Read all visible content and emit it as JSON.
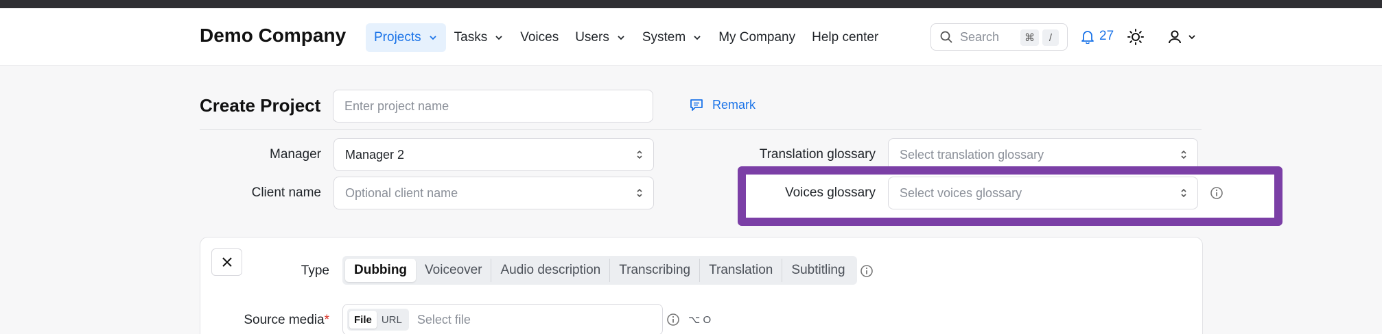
{
  "header": {
    "brand": "Demo Company",
    "nav": [
      {
        "label": "Projects",
        "has_dropdown": true,
        "active": true
      },
      {
        "label": "Tasks",
        "has_dropdown": true
      },
      {
        "label": "Voices",
        "has_dropdown": false
      },
      {
        "label": "Users",
        "has_dropdown": true
      },
      {
        "label": "System",
        "has_dropdown": true
      },
      {
        "label": "My Company",
        "has_dropdown": false
      },
      {
        "label": "Help center",
        "has_dropdown": false
      }
    ],
    "search": {
      "placeholder": "Search",
      "kbd_cmd": "⌘",
      "kbd_key": "/"
    },
    "notifications": {
      "count": "27",
      "icon": "bell-icon"
    },
    "theme_icon": "sun-icon",
    "user_icon": "user-icon"
  },
  "form": {
    "title": "Create Project",
    "project_name_placeholder": "Enter project name",
    "remark_label": "Remark",
    "manager_label": "Manager",
    "manager_value": "Manager 2",
    "client_label": "Client name",
    "client_placeholder": "Optional client name",
    "translation_glossary_label": "Translation glossary",
    "translation_glossary_placeholder": "Select translation glossary",
    "voices_glossary_label": "Voices glossary",
    "voices_glossary_placeholder": "Select voices glossary"
  },
  "task": {
    "type_label": "Type",
    "types": [
      "Dubbing",
      "Voiceover",
      "Audio description",
      "Transcribing",
      "Translation",
      "Subtitling"
    ],
    "selected_type": "Dubbing",
    "source_label": "Source media",
    "required_mark": "*",
    "source_modes": [
      "File",
      "URL"
    ],
    "source_placeholder": "Select file",
    "shortcut": "⌥ O"
  },
  "colors": {
    "accent": "#1a73e8",
    "highlight": "#7b3fa6",
    "required": "#d93025"
  }
}
